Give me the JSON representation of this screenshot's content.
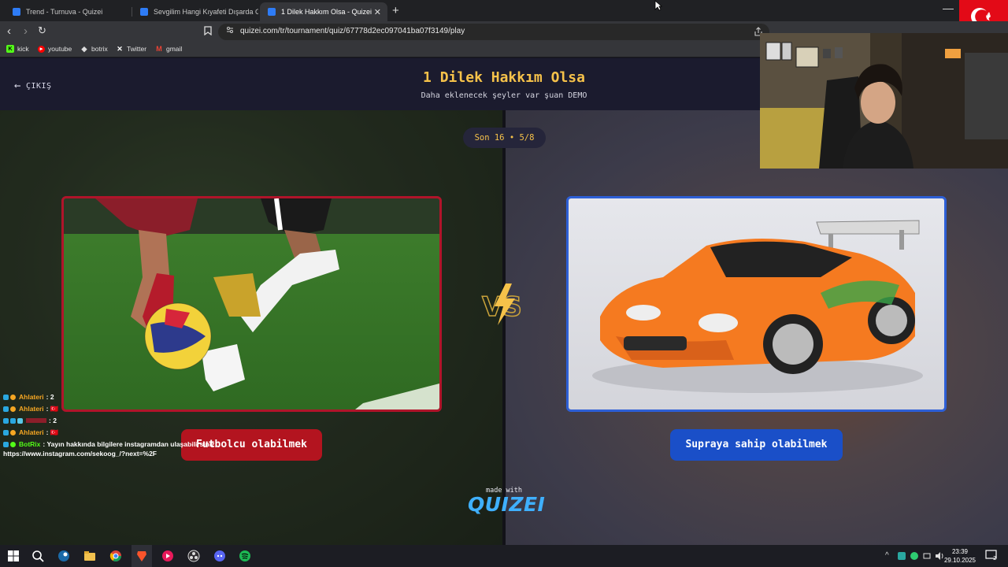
{
  "browser": {
    "tabs": [
      {
        "label": "Trend - Turnuva - Quizei",
        "active": false
      },
      {
        "label": "Sevgilim Hangi Kıyafeti Dışarda Giyeb",
        "active": false
      },
      {
        "label": "1 Dilek Hakkım Olsa - Quizei",
        "active": true
      }
    ],
    "url": "quizei.com/tr/tournament/quiz/67778d2ec097041ba07f3149/play",
    "bookmarks": [
      "kick",
      "youtube",
      "botrix",
      "Twitter",
      "gmail"
    ]
  },
  "page": {
    "back_label": "ÇIKIŞ",
    "title": "1 Dilek Hakkım Olsa",
    "subtitle": "Daha eklenecek şeyler var şuan DEMO",
    "round": "Son 16 • 5/8",
    "left_choice": "Futbolcu olabilmek",
    "right_choice": "Supraya sahip olabilmek",
    "vs_label": "VS",
    "made_with": "made with",
    "brand": "QUIZEI"
  },
  "chat": {
    "lines": [
      {
        "user": "Ahlateri",
        "message": "2"
      },
      {
        "user": "Ahlateri",
        "message": "🇹🇷"
      },
      {
        "user": "",
        "message": "2"
      },
      {
        "user": "Ahlateri",
        "message": "🇹🇷"
      },
      {
        "user": "BotRix",
        "message": "Yayın hakkında bilgilere instagramdan ulaşabilirsiniz"
      }
    ],
    "link": "https://www.instagram.com/sekoog_/?next=%2F"
  },
  "taskbar": {
    "time": "23:39",
    "date": "29.10.2025",
    "notification_count": "2"
  },
  "colors": {
    "accent_yellow": "#f6c24a",
    "left_red": "#b3141f",
    "right_blue": "#1a4fc8",
    "header_bg": "#1b1b2e"
  }
}
